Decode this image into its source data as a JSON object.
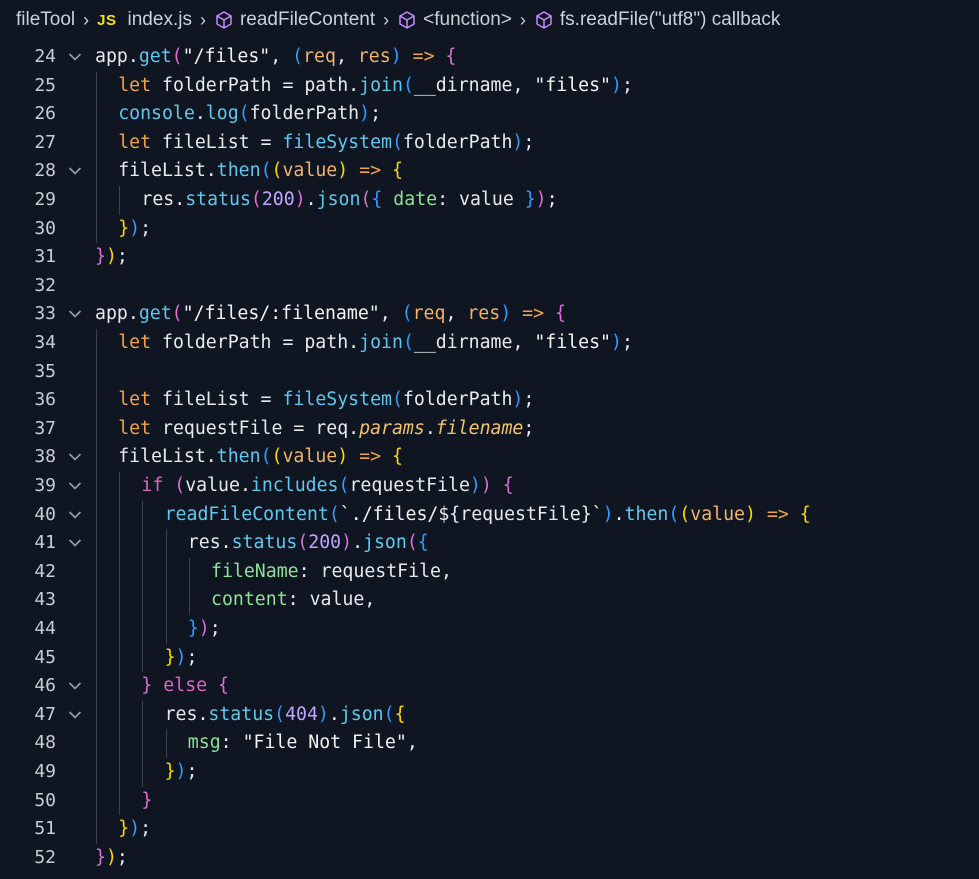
{
  "breadcrumb": {
    "items": [
      "fileTool",
      "JS",
      "index.js",
      "readFileContent",
      "<function>",
      "fs.readFile(\"utf8\") callback"
    ],
    "separator": ">"
  },
  "editor": {
    "lines": [
      {
        "n": "24",
        "fold": true,
        "indent": 0
      },
      {
        "n": "25",
        "fold": false,
        "indent": 1
      },
      {
        "n": "26",
        "fold": false,
        "indent": 1
      },
      {
        "n": "27",
        "fold": false,
        "indent": 1
      },
      {
        "n": "28",
        "fold": true,
        "indent": 1
      },
      {
        "n": "29",
        "fold": false,
        "indent": 2
      },
      {
        "n": "30",
        "fold": false,
        "indent": 1
      },
      {
        "n": "31",
        "fold": false,
        "indent": 0
      },
      {
        "n": "32",
        "fold": false,
        "indent": 0
      },
      {
        "n": "33",
        "fold": true,
        "indent": 0
      },
      {
        "n": "34",
        "fold": false,
        "indent": 1
      },
      {
        "n": "35",
        "fold": false,
        "indent": 1
      },
      {
        "n": "36",
        "fold": false,
        "indent": 1
      },
      {
        "n": "37",
        "fold": false,
        "indent": 1
      },
      {
        "n": "38",
        "fold": true,
        "indent": 1
      },
      {
        "n": "39",
        "fold": true,
        "indent": 2
      },
      {
        "n": "40",
        "fold": true,
        "indent": 3
      },
      {
        "n": "41",
        "fold": true,
        "indent": 4
      },
      {
        "n": "42",
        "fold": false,
        "indent": 5
      },
      {
        "n": "43",
        "fold": false,
        "indent": 5
      },
      {
        "n": "44",
        "fold": false,
        "indent": 4
      },
      {
        "n": "45",
        "fold": false,
        "indent": 3
      },
      {
        "n": "46",
        "fold": true,
        "indent": 2
      },
      {
        "n": "47",
        "fold": true,
        "indent": 3
      },
      {
        "n": "48",
        "fold": false,
        "indent": 4
      },
      {
        "n": "49",
        "fold": false,
        "indent": 3
      },
      {
        "n": "50",
        "fold": false,
        "indent": 2
      },
      {
        "n": "51",
        "fold": false,
        "indent": 1
      },
      {
        "n": "52",
        "fold": false,
        "indent": 0
      }
    ],
    "tokens": [
      [
        [
          "obj",
          "app"
        ],
        [
          "op",
          "."
        ],
        [
          "fn",
          "get"
        ],
        [
          "b2",
          "("
        ],
        [
          "str",
          "\"/files\""
        ],
        [
          "op",
          ", "
        ],
        [
          "b3",
          "("
        ],
        [
          "par",
          "req"
        ],
        [
          "op",
          ", "
        ],
        [
          "par",
          "res"
        ],
        [
          "b3",
          ")"
        ],
        [
          "op",
          " "
        ],
        [
          "arrow",
          "=>"
        ],
        [
          "op",
          " "
        ],
        [
          "b2",
          "{"
        ]
      ],
      [
        [
          "kw",
          "let "
        ],
        [
          "obj",
          "folderPath"
        ],
        [
          "op",
          " = "
        ],
        [
          "obj",
          "path"
        ],
        [
          "op",
          "."
        ],
        [
          "fn",
          "join"
        ],
        [
          "b3",
          "("
        ],
        [
          "obj",
          "__dirname"
        ],
        [
          "op",
          ", "
        ],
        [
          "str",
          "\"files\""
        ],
        [
          "b3",
          ")"
        ],
        [
          "op",
          ";"
        ]
      ],
      [
        [
          "fn",
          "console"
        ],
        [
          "op",
          "."
        ],
        [
          "fn",
          "log"
        ],
        [
          "b3",
          "("
        ],
        [
          "obj",
          "folderPath"
        ],
        [
          "b3",
          ")"
        ],
        [
          "op",
          ";"
        ]
      ],
      [
        [
          "kw",
          "let "
        ],
        [
          "obj",
          "fileList"
        ],
        [
          "op",
          " = "
        ],
        [
          "fn",
          "fileSystem"
        ],
        [
          "b3",
          "("
        ],
        [
          "obj",
          "folderPath"
        ],
        [
          "b3",
          ")"
        ],
        [
          "op",
          ";"
        ]
      ],
      [
        [
          "obj",
          "fileList"
        ],
        [
          "op",
          "."
        ],
        [
          "fn",
          "then"
        ],
        [
          "b3",
          "("
        ],
        [
          "b1",
          "("
        ],
        [
          "par",
          "value"
        ],
        [
          "b1",
          ")"
        ],
        [
          "op",
          " "
        ],
        [
          "arrow",
          "=>"
        ],
        [
          "op",
          " "
        ],
        [
          "b1",
          "{"
        ]
      ],
      [
        [
          "obj",
          "res"
        ],
        [
          "op",
          "."
        ],
        [
          "fn",
          "status"
        ],
        [
          "b2",
          "("
        ],
        [
          "num",
          "200"
        ],
        [
          "b2",
          ")"
        ],
        [
          "op",
          "."
        ],
        [
          "fn",
          "json"
        ],
        [
          "b2",
          "("
        ],
        [
          "b3",
          "{"
        ],
        [
          "op",
          " "
        ],
        [
          "prop",
          "date"
        ],
        [
          "op",
          ": "
        ],
        [
          "obj",
          "value"
        ],
        [
          "op",
          " "
        ],
        [
          "b3",
          "}"
        ],
        [
          "b2",
          ")"
        ],
        [
          "op",
          ";"
        ]
      ],
      [
        [
          "b1",
          "}"
        ],
        [
          "b3",
          ")"
        ],
        [
          "op",
          ";"
        ]
      ],
      [
        [
          "b2",
          "}"
        ],
        [
          "b1",
          ")"
        ],
        [
          "op",
          ";"
        ]
      ],
      [],
      [
        [
          "obj",
          "app"
        ],
        [
          "op",
          "."
        ],
        [
          "fn",
          "get"
        ],
        [
          "b2",
          "("
        ],
        [
          "str",
          "\"/files/:filename\""
        ],
        [
          "op",
          ", "
        ],
        [
          "b3",
          "("
        ],
        [
          "par",
          "req"
        ],
        [
          "op",
          ", "
        ],
        [
          "par",
          "res"
        ],
        [
          "b3",
          ")"
        ],
        [
          "op",
          " "
        ],
        [
          "arrow",
          "=>"
        ],
        [
          "op",
          " "
        ],
        [
          "b2",
          "{"
        ]
      ],
      [
        [
          "kw",
          "let "
        ],
        [
          "obj",
          "folderPath"
        ],
        [
          "op",
          " = "
        ],
        [
          "obj",
          "path"
        ],
        [
          "op",
          "."
        ],
        [
          "fn",
          "join"
        ],
        [
          "b3",
          "("
        ],
        [
          "obj",
          "__dirname"
        ],
        [
          "op",
          ", "
        ],
        [
          "str",
          "\"files\""
        ],
        [
          "b3",
          ")"
        ],
        [
          "op",
          ";"
        ]
      ],
      [],
      [
        [
          "kw",
          "let "
        ],
        [
          "obj",
          "fileList"
        ],
        [
          "op",
          " = "
        ],
        [
          "fn",
          "fileSystem"
        ],
        [
          "b3",
          "("
        ],
        [
          "obj",
          "folderPath"
        ],
        [
          "b3",
          ")"
        ],
        [
          "op",
          ";"
        ]
      ],
      [
        [
          "kw",
          "let "
        ],
        [
          "obj",
          "requestFile"
        ],
        [
          "op",
          " = "
        ],
        [
          "obj",
          "req"
        ],
        [
          "op",
          "."
        ],
        [
          "it",
          "params"
        ],
        [
          "op",
          "."
        ],
        [
          "it",
          "filename"
        ],
        [
          "op",
          ";"
        ]
      ],
      [
        [
          "obj",
          "fileList"
        ],
        [
          "op",
          "."
        ],
        [
          "fn",
          "then"
        ],
        [
          "b3",
          "("
        ],
        [
          "b1",
          "("
        ],
        [
          "par",
          "value"
        ],
        [
          "b1",
          ")"
        ],
        [
          "op",
          " "
        ],
        [
          "arrow",
          "=>"
        ],
        [
          "op",
          " "
        ],
        [
          "b1",
          "{"
        ]
      ],
      [
        [
          "ctl",
          "if "
        ],
        [
          "b2",
          "("
        ],
        [
          "obj",
          "value"
        ],
        [
          "op",
          "."
        ],
        [
          "fn",
          "includes"
        ],
        [
          "b3",
          "("
        ],
        [
          "obj",
          "requestFile"
        ],
        [
          "b3",
          ")"
        ],
        [
          "b2",
          ")"
        ],
        [
          "op",
          " "
        ],
        [
          "b2",
          "{"
        ]
      ],
      [
        [
          "fn",
          "readFileContent"
        ],
        [
          "b3",
          "("
        ],
        [
          "tpl",
          "`./files/"
        ],
        [
          "op",
          "${"
        ],
        [
          "obj",
          "requestFile"
        ],
        [
          "op",
          "}"
        ],
        [
          "tpl",
          "`"
        ],
        [
          "b3",
          ")"
        ],
        [
          "op",
          "."
        ],
        [
          "fn",
          "then"
        ],
        [
          "b3",
          "("
        ],
        [
          "b1",
          "("
        ],
        [
          "par",
          "value"
        ],
        [
          "b1",
          ")"
        ],
        [
          "op",
          " "
        ],
        [
          "arrow",
          "=>"
        ],
        [
          "op",
          " "
        ],
        [
          "b1",
          "{"
        ]
      ],
      [
        [
          "obj",
          "res"
        ],
        [
          "op",
          "."
        ],
        [
          "fn",
          "status"
        ],
        [
          "b2",
          "("
        ],
        [
          "num",
          "200"
        ],
        [
          "b2",
          ")"
        ],
        [
          "op",
          "."
        ],
        [
          "fn",
          "json"
        ],
        [
          "b2",
          "("
        ],
        [
          "b3",
          "{"
        ]
      ],
      [
        [
          "prop",
          "fileName"
        ],
        [
          "op",
          ": "
        ],
        [
          "obj",
          "requestFile"
        ],
        [
          "op",
          ","
        ]
      ],
      [
        [
          "prop",
          "content"
        ],
        [
          "op",
          ": "
        ],
        [
          "obj",
          "value"
        ],
        [
          "op",
          ","
        ]
      ],
      [
        [
          "b3",
          "}"
        ],
        [
          "b2",
          ")"
        ],
        [
          "op",
          ";"
        ]
      ],
      [
        [
          "b1",
          "}"
        ],
        [
          "b3",
          ")"
        ],
        [
          "op",
          ";"
        ]
      ],
      [
        [
          "b2",
          "}"
        ],
        [
          "op",
          " "
        ],
        [
          "ctl",
          "else "
        ],
        [
          "b2",
          "{"
        ]
      ],
      [
        [
          "obj",
          "res"
        ],
        [
          "op",
          "."
        ],
        [
          "fn",
          "status"
        ],
        [
          "b3",
          "("
        ],
        [
          "num",
          "404"
        ],
        [
          "b3",
          ")"
        ],
        [
          "op",
          "."
        ],
        [
          "fn",
          "json"
        ],
        [
          "b3",
          "("
        ],
        [
          "b1",
          "{"
        ]
      ],
      [
        [
          "prop",
          "msg"
        ],
        [
          "op",
          ": "
        ],
        [
          "str",
          "\"File Not File\""
        ],
        [
          "op",
          ","
        ]
      ],
      [
        [
          "b1",
          "}"
        ],
        [
          "b3",
          ")"
        ],
        [
          "op",
          ";"
        ]
      ],
      [
        [
          "b2",
          "}"
        ]
      ],
      [
        [
          "b1",
          "}"
        ],
        [
          "b3",
          ")"
        ],
        [
          "op",
          ";"
        ]
      ],
      [
        [
          "b2",
          "}"
        ],
        [
          "b1",
          ")"
        ],
        [
          "op",
          ";"
        ]
      ]
    ]
  },
  "colors": {
    "background": "#0f1521",
    "keyword": "#f2a24b",
    "function": "#5ec9f0",
    "property": "#8fe09a",
    "number": "#c2a3ff"
  }
}
